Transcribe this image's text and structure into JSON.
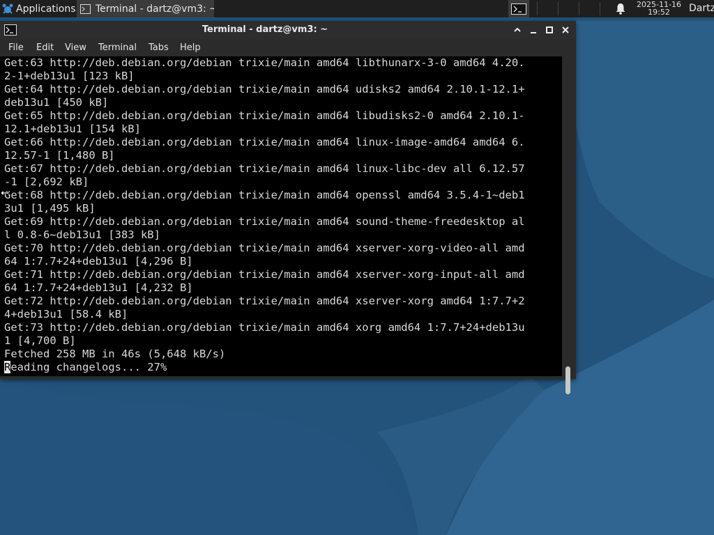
{
  "theme": {
    "panel_bg": "#1f1f1f",
    "window_bg": "#2b2b2b",
    "terminal_bg": "#000000",
    "terminal_fg": "#d8d8d8",
    "desktop_blue": "#2a5578"
  },
  "panel": {
    "applications_label": "Applications",
    "applications_icon": "xfce-mouse-logo",
    "task_label": "Terminal - dartz@vm3: ~",
    "task_icon": "terminal-icon",
    "launcher_icon": "terminal-icon",
    "notification_icon": "bell-icon",
    "date": "2025-11-16",
    "time": "19:52",
    "user": "Dartz"
  },
  "window": {
    "title": "Terminal - dartz@vm3: ~",
    "icon": "terminal-icon",
    "buttons": [
      "maximize-up-icon",
      "minimize-icon",
      "restore-icon",
      "close-icon"
    ],
    "menu": [
      "File",
      "Edit",
      "View",
      "Terminal",
      "Tabs",
      "Help"
    ]
  },
  "terminal": {
    "lines": [
      "Get:63 http://deb.debian.org/debian trixie/main amd64 libthunarx-3-0 amd64 4.20.",
      "2-1+deb13u1 [123 kB]",
      "Get:64 http://deb.debian.org/debian trixie/main amd64 udisks2 amd64 2.10.1-12.1+",
      "deb13u1 [450 kB]",
      "Get:65 http://deb.debian.org/debian trixie/main amd64 libudisks2-0 amd64 2.10.1-",
      "12.1+deb13u1 [154 kB]",
      "Get:66 http://deb.debian.org/debian trixie/main amd64 linux-image-amd64 amd64 6.",
      "12.57-1 [1,480 B]",
      "Get:67 http://deb.debian.org/debian trixie/main amd64 linux-libc-dev all 6.12.57",
      "-1 [2,692 kB]",
      "Get:68 http://deb.debian.org/debian trixie/main amd64 openssl amd64 3.5.4-1~deb1",
      "3u1 [1,495 kB]",
      "Get:69 http://deb.debian.org/debian trixie/main amd64 sound-theme-freedesktop al",
      "l 0.8-6~deb13u1 [383 kB]",
      "Get:70 http://deb.debian.org/debian trixie/main amd64 xserver-xorg-video-all amd",
      "64 1:7.7+24+deb13u1 [4,296 B]",
      "Get:71 http://deb.debian.org/debian trixie/main amd64 xserver-xorg-input-all amd",
      "64 1:7.7+24+deb13u1 [4,232 B]",
      "Get:72 http://deb.debian.org/debian trixie/main amd64 xserver-xorg amd64 1:7.7+2",
      "4+deb13u1 [58.4 kB]",
      "Get:73 http://deb.debian.org/debian trixie/main amd64 xorg amd64 1:7.7+24+deb13u",
      "1 [4,700 B]",
      "Fetched 258 MB in 46s (5,648 kB/s)"
    ],
    "prompt_cursor_char": "R",
    "prompt_rest": "eading changelogs... 27%"
  }
}
